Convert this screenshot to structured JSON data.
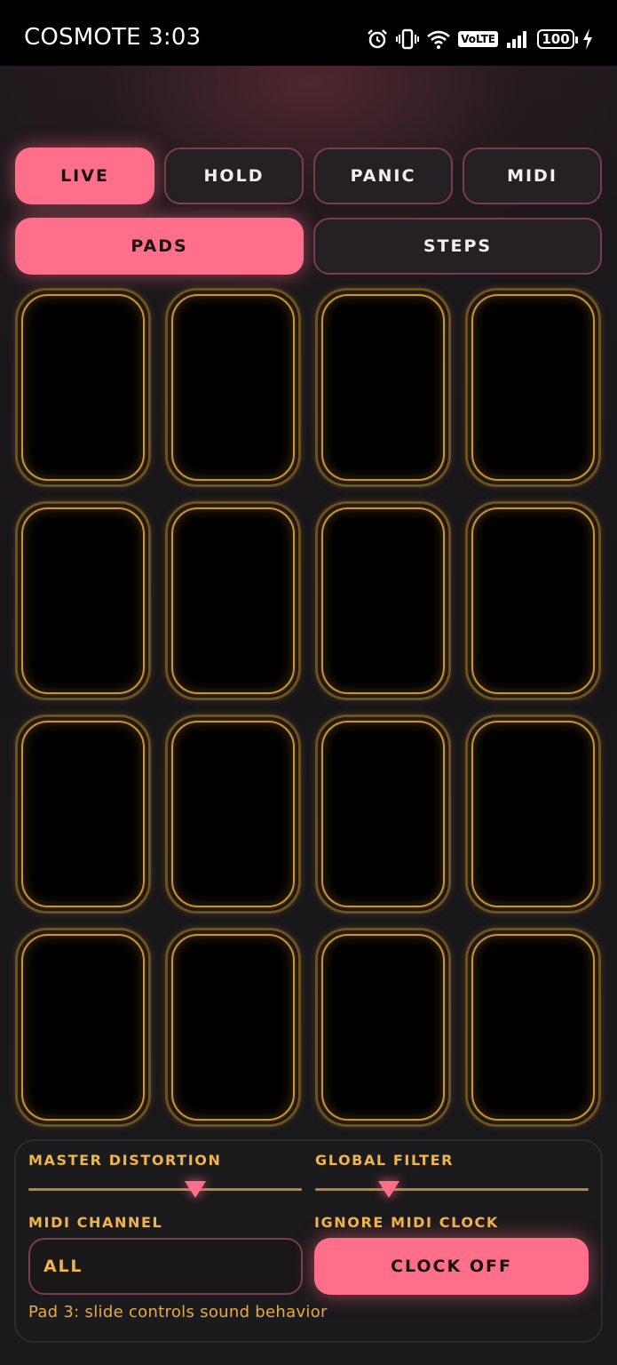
{
  "status_bar": {
    "carrier_time": "COSMOTE 3:03",
    "volte": "VoLTE",
    "battery": "100",
    "icons": [
      "alarm-icon",
      "vibrate-icon",
      "wifi-icon",
      "volte-icon",
      "signal-icon",
      "battery-icon",
      "charging-icon"
    ]
  },
  "mode_buttons": {
    "live": "LIVE",
    "hold": "HOLD",
    "panic": "PANIC",
    "midi": "MIDI"
  },
  "view_tabs": {
    "pads": "PADS",
    "steps": "STEPS"
  },
  "pads": {
    "count": 16,
    "rows": 4,
    "columns": 4
  },
  "controls": {
    "master_distortion": {
      "label": "MASTER DISTORTION",
      "value_fraction": 0.61
    },
    "global_filter": {
      "label": "GLOBAL FILTER",
      "value_fraction": 0.27
    },
    "midi_channel": {
      "label": "MIDI CHANNEL",
      "value": "ALL"
    },
    "ignore_midi_clock": {
      "label": "IGNORE MIDI CLOCK",
      "button": "CLOCK OFF"
    }
  },
  "status_message": "Pad 3: slide controls sound behavior",
  "colors": {
    "accent_pink": "#ff6f89",
    "pad_gold": "#c89436",
    "label_amber": "#f0b548",
    "background": "#17161a"
  }
}
